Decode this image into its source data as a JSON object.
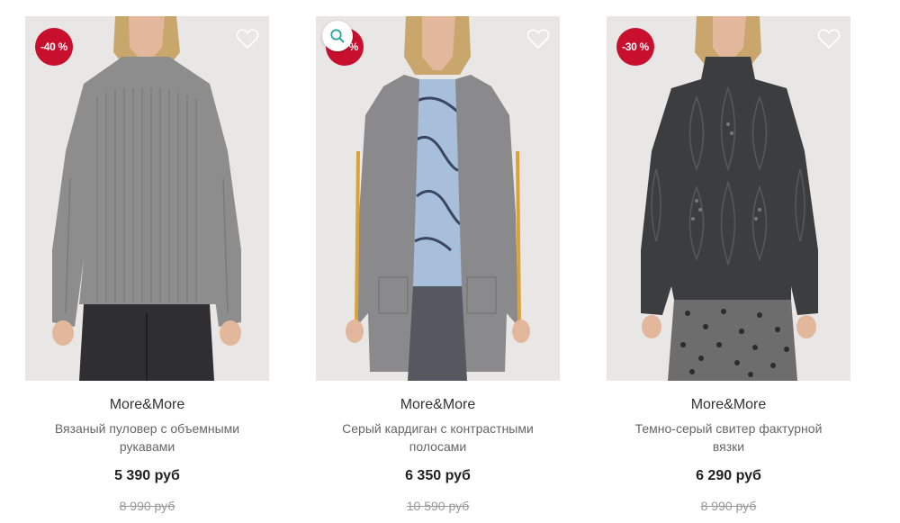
{
  "products": [
    {
      "badge": "-40 %",
      "brand": "More&More",
      "name": "Вязаный пуловер с объемными рукавами",
      "price": "5 390 руб",
      "old_price": "8 990 руб",
      "colors": {
        "garment": "#8d8d8d",
        "pants": "#2f2f31"
      }
    },
    {
      "badge": "%",
      "brand": "More&More",
      "name": "Серый кардиган с контрастными полосами",
      "price": "6 350 руб",
      "old_price": "10 590 руб",
      "colors": {
        "garment": "#8a8a8c",
        "pants": "#55585e",
        "stripe": "#d9a33a",
        "top": "#a8bfdc"
      }
    },
    {
      "badge": "-30 %",
      "brand": "More&More",
      "name": "Темно-серый свитер фактурной вязки",
      "price": "6 290 руб",
      "old_price": "8 990 руб",
      "colors": {
        "garment": "#3c3d3f",
        "skirt": "#6d6d6d"
      }
    }
  ],
  "icons": {
    "wishlist": "heart-outline-icon",
    "zoom": "search-icon"
  },
  "accent": "#c8102e"
}
